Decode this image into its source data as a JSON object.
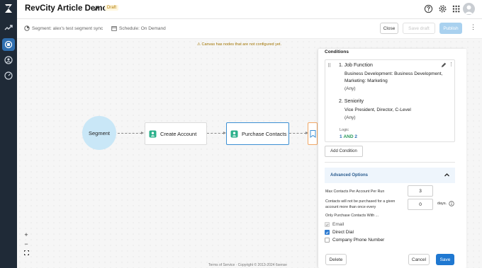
{
  "header": {
    "title": "RevCity Article Demo",
    "badge": "Draft",
    "icons": [
      "help-icon",
      "gear-icon",
      "grid-icon",
      "avatar"
    ]
  },
  "subheader": {
    "segment": "Segment: alex's test segment sync",
    "schedule": "Schedule: On Demand",
    "close_label": "Close",
    "save_draft_label": "Save draft",
    "publish_label": "Publish"
  },
  "canvas": {
    "warning": "Canvas has nodes that are not configured yet.",
    "segment_node": "Segment",
    "nodes": [
      "Create Account",
      "Purchase Contacts"
    ],
    "zoom_in": "+",
    "zoom_out": "−",
    "footer": "Terms of Service · Copyright © 2013-2024 6sense"
  },
  "panel": {
    "title": "Conditions",
    "conditions": [
      {
        "heading": "1. Job Function",
        "values": "Business Development: Business Development, Marketing: Marketing",
        "qualifier": "(Any)"
      },
      {
        "heading": "2. Seniority",
        "values": "Vice President, Director, C-Level",
        "qualifier": "(Any)"
      }
    ],
    "logic_label": "Logic",
    "logic": {
      "first": "1",
      "op": "AND",
      "second": "2"
    },
    "add_condition_label": "Add Condition",
    "advanced_label": "Advanced Options",
    "max_contacts_label": "Max Contacts Per Account Per Run",
    "max_contacts_value": "3",
    "repurchase_label": "Contacts will not be purchased for a given account more than once every",
    "repurchase_value": "0",
    "days_label": "days.",
    "only_purchase_label": "Only Purchase Contacts With ...",
    "checkboxes": [
      {
        "label": "Email",
        "checked": true,
        "disabled": true
      },
      {
        "label": "Direct Dial",
        "checked": true,
        "disabled": false
      },
      {
        "label": "Company Phone Number",
        "checked": false,
        "disabled": false
      }
    ],
    "delete_label": "Delete",
    "cancel_label": "Cancel",
    "save_label": "Save"
  },
  "colors": {
    "rail": "#1f2a37",
    "accent": "#1f78d1",
    "segment_fill": "#c9e7f7",
    "warning": "#a07300"
  }
}
